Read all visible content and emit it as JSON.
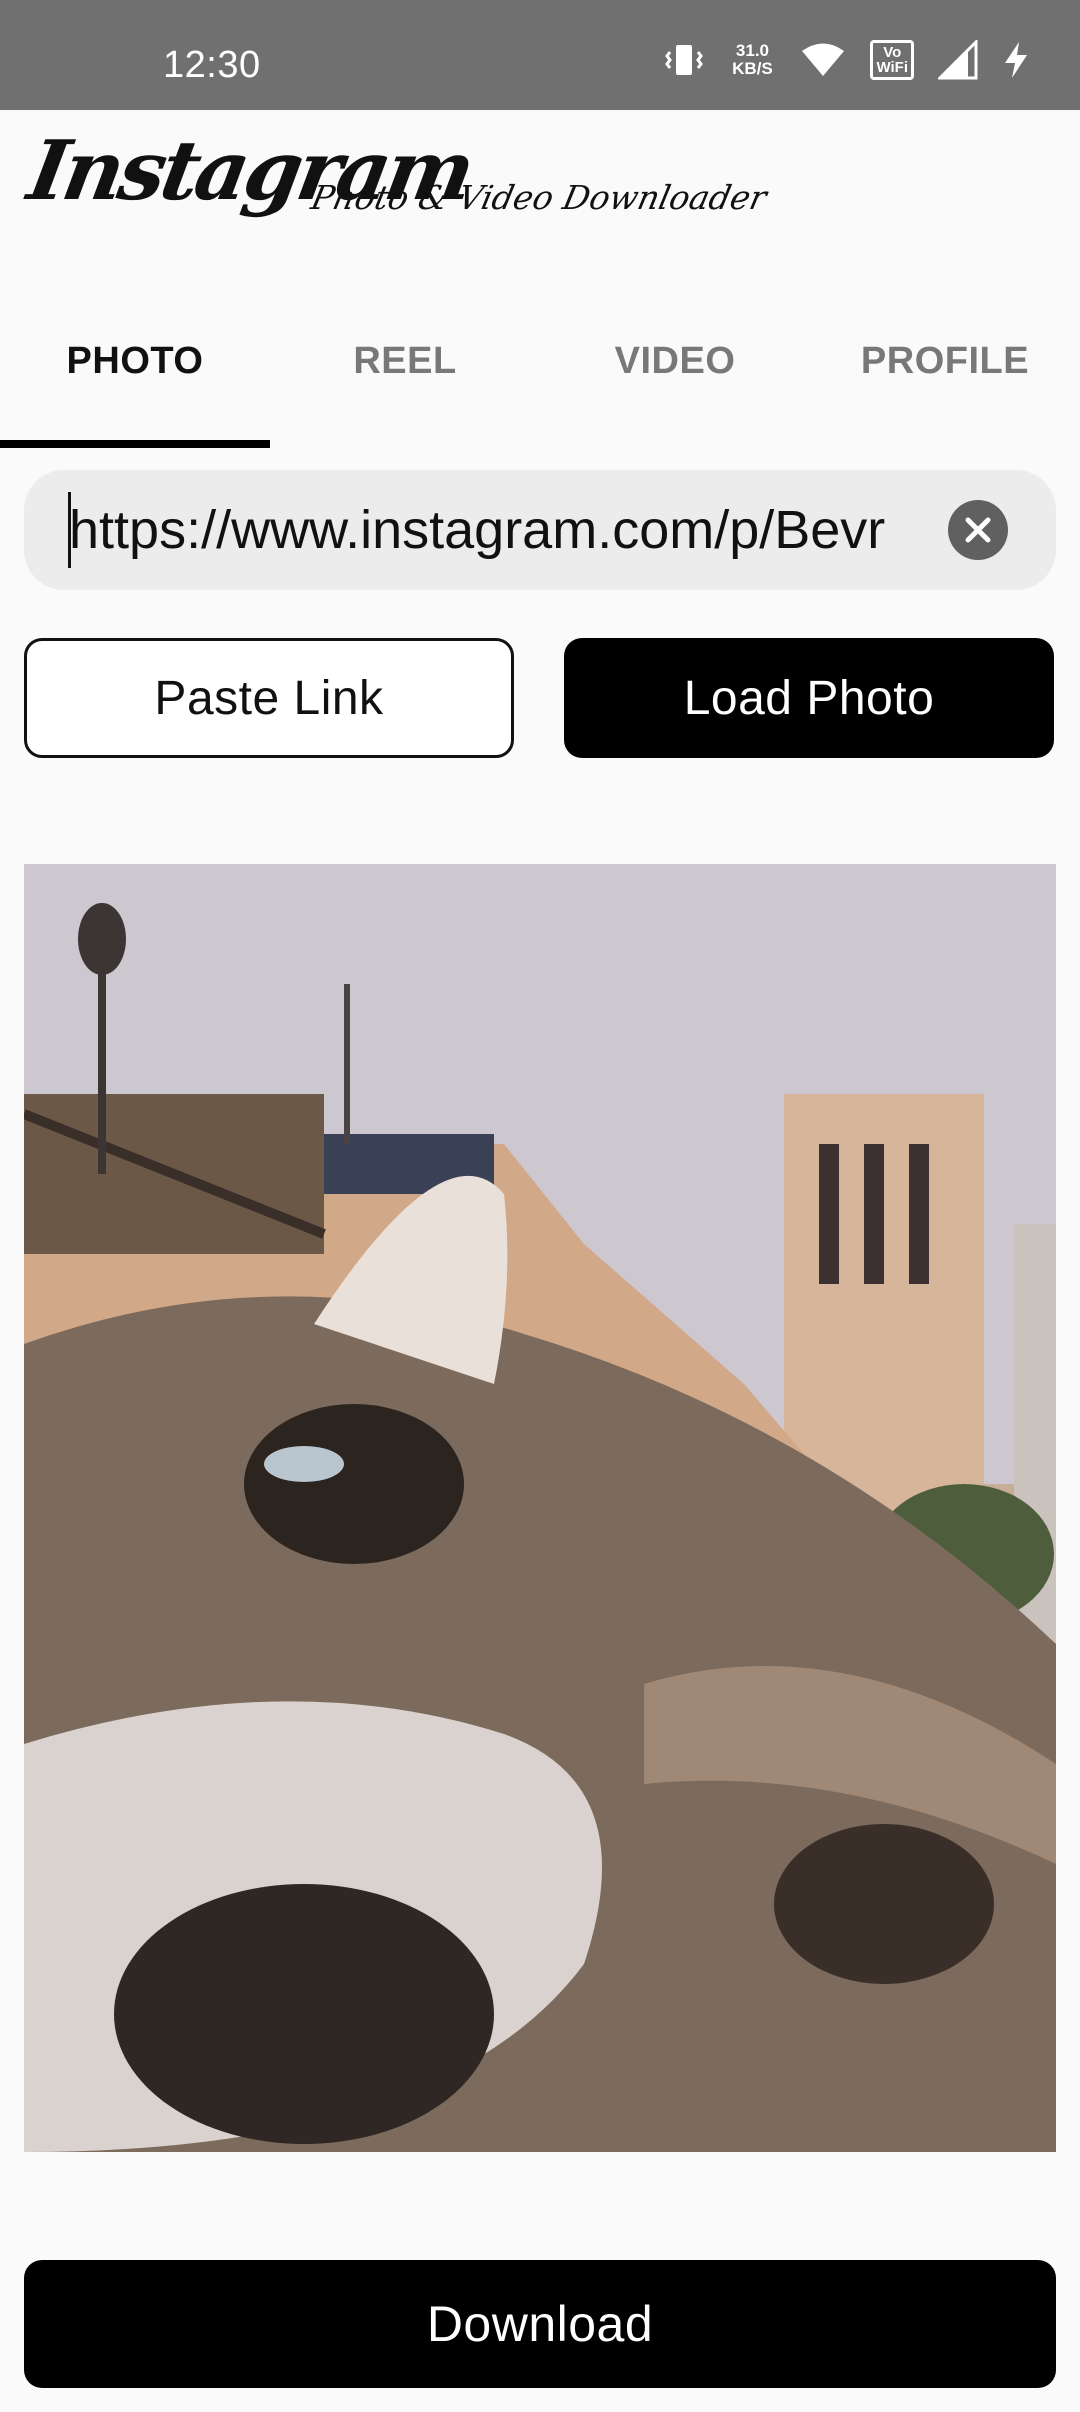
{
  "status_bar": {
    "time": "12:30",
    "net_speed_value": "31.0",
    "net_speed_unit": "KB/S",
    "volte_label": "Vo",
    "wifi_label": "WiFi",
    "icons": [
      "vibrate-icon",
      "wifi-icon",
      "volte-wifi-icon",
      "signal-icon",
      "charging-icon"
    ]
  },
  "header": {
    "logo_title": "Instagram",
    "logo_subtitle": "Photo & Video Downloader"
  },
  "tabs": [
    {
      "label": "PHOTO",
      "active": true
    },
    {
      "label": "REEL",
      "active": false
    },
    {
      "label": "VIDEO",
      "active": false
    },
    {
      "label": "PROFILE",
      "active": false
    }
  ],
  "url_input": {
    "value": "https://www.instagram.com/p/Bevr",
    "clear_icon": "close-icon"
  },
  "buttons": {
    "paste": "Paste Link",
    "load": "Load Photo",
    "download": "Download"
  },
  "colors": {
    "primary": "#000000",
    "background": "#fafafa",
    "status_bar": "#707070",
    "inactive_tab": "#787878"
  }
}
